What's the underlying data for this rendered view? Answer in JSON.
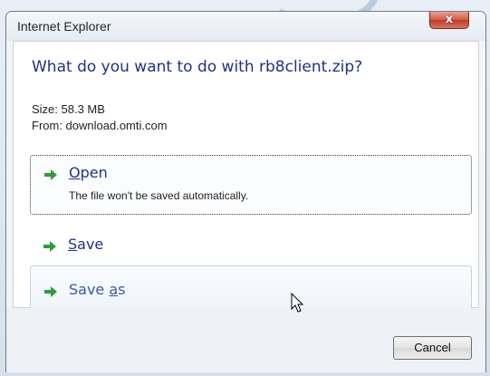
{
  "window": {
    "title": "Internet Explorer",
    "close_label": "x"
  },
  "prompt": {
    "question": "What do you want to do with rb8client.zip?",
    "size": "Size: 58.3 MB",
    "from": "From: download.omti.com"
  },
  "options": [
    {
      "label_first": "O",
      "label_rest": "pen",
      "description": "The file won't be saved automatically.",
      "icon": "green-arrow-icon"
    },
    {
      "label_first": "S",
      "label_rest": "ave",
      "icon": "green-arrow-icon"
    },
    {
      "label_pre": "Save ",
      "label_ul": "a",
      "label_post": "s",
      "icon": "green-arrow-icon"
    }
  ],
  "footer": {
    "cancel_label": "Cancel"
  },
  "colors": {
    "heading": "#1e3287",
    "arrow": "#2e9d3a",
    "close": "#c0392b"
  }
}
